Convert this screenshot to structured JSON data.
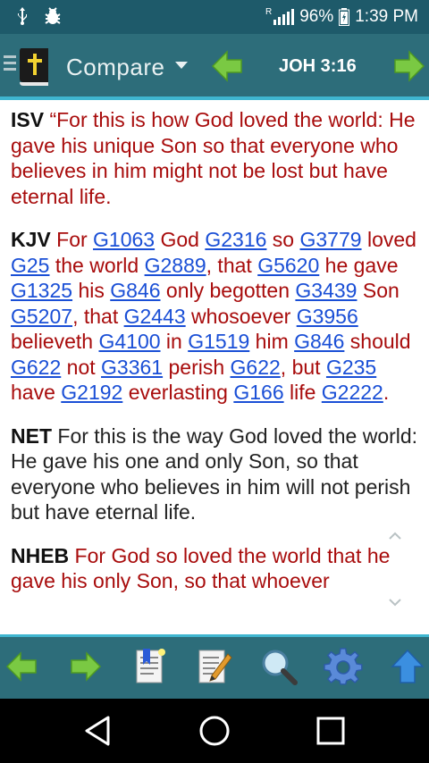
{
  "status_bar": {
    "battery": "96%",
    "time": "1:39 PM",
    "icons": [
      "usb-icon",
      "bug-icon",
      "signal-icon",
      "battery-icon"
    ],
    "roaming_label": "R"
  },
  "action_bar": {
    "title": "Compare",
    "reference": "JOH 3:16",
    "icons": [
      "menu-icon",
      "bible-icon",
      "dropdown-caret-icon",
      "prev-arrow-icon",
      "next-arrow-icon"
    ]
  },
  "verses": [
    {
      "version": "ISV",
      "color": "#a80c0c",
      "segments": [
        {
          "t": " “For this is how God loved the world: He gave his unique Son so that everyone who believes in him might not be lost but have eternal life."
        }
      ]
    },
    {
      "version": "KJV",
      "color": "#a80c0c",
      "segments": [
        {
          "t": " For "
        },
        {
          "t": "G1063",
          "link": true
        },
        {
          "t": " God "
        },
        {
          "t": "G2316",
          "link": true
        },
        {
          "t": " so "
        },
        {
          "t": "G3779",
          "link": true
        },
        {
          "t": " loved "
        },
        {
          "t": "G25",
          "link": true
        },
        {
          "t": " the world "
        },
        {
          "t": "G2889",
          "link": true
        },
        {
          "t": ", that "
        },
        {
          "t": "G5620",
          "link": true
        },
        {
          "t": " he gave "
        },
        {
          "t": "G1325",
          "link": true
        },
        {
          "t": " his "
        },
        {
          "t": "G846",
          "link": true
        },
        {
          "t": " only begotten "
        },
        {
          "t": "G3439",
          "link": true
        },
        {
          "t": " Son "
        },
        {
          "t": "G5207",
          "link": true
        },
        {
          "t": ", that "
        },
        {
          "t": "G2443",
          "link": true
        },
        {
          "t": " whosoever "
        },
        {
          "t": "G3956",
          "link": true
        },
        {
          "t": " believeth "
        },
        {
          "t": "G4100",
          "link": true
        },
        {
          "t": " in "
        },
        {
          "t": "G1519",
          "link": true
        },
        {
          "t": " him "
        },
        {
          "t": "G846",
          "link": true
        },
        {
          "t": " should "
        },
        {
          "t": "G622",
          "link": true
        },
        {
          "t": " not "
        },
        {
          "t": "G3361",
          "link": true
        },
        {
          "t": " perish "
        },
        {
          "t": "G622",
          "link": true
        },
        {
          "t": ", but "
        },
        {
          "t": "G235",
          "link": true
        },
        {
          "t": " have "
        },
        {
          "t": "G2192",
          "link": true
        },
        {
          "t": " everlasting "
        },
        {
          "t": "G166",
          "link": true
        },
        {
          "t": " life "
        },
        {
          "t": "G2222",
          "link": true
        },
        {
          "t": "."
        }
      ]
    },
    {
      "version": "NET",
      "color": "#222222",
      "segments": [
        {
          "t": " For this is the way God loved the world: He gave his one and only Son, so that everyone who believes in him will not perish but have eternal life."
        }
      ]
    },
    {
      "version": "NHEB",
      "color": "#a80c0c",
      "segments": [
        {
          "t": " For God so loved the world that he gave his only Son, so that whoever"
        }
      ]
    }
  ],
  "bottom_toolbar": {
    "buttons": [
      "back-arrow-icon",
      "forward-arrow-icon",
      "bookmark-icon",
      "note-edit-icon",
      "search-icon",
      "settings-icon",
      "scroll-top-icon"
    ]
  },
  "nav_bar": {
    "buttons": [
      "back-triangle-icon",
      "home-circle-icon",
      "recents-square-icon"
    ]
  },
  "colors": {
    "status_bar": "#1e5a6a",
    "action_bar": "#2d6d7a",
    "accent_line": "#3fb6d0",
    "words_of_jesus": "#a80c0c",
    "link": "#1a4fd6",
    "arrow_green": "#7ac943"
  }
}
